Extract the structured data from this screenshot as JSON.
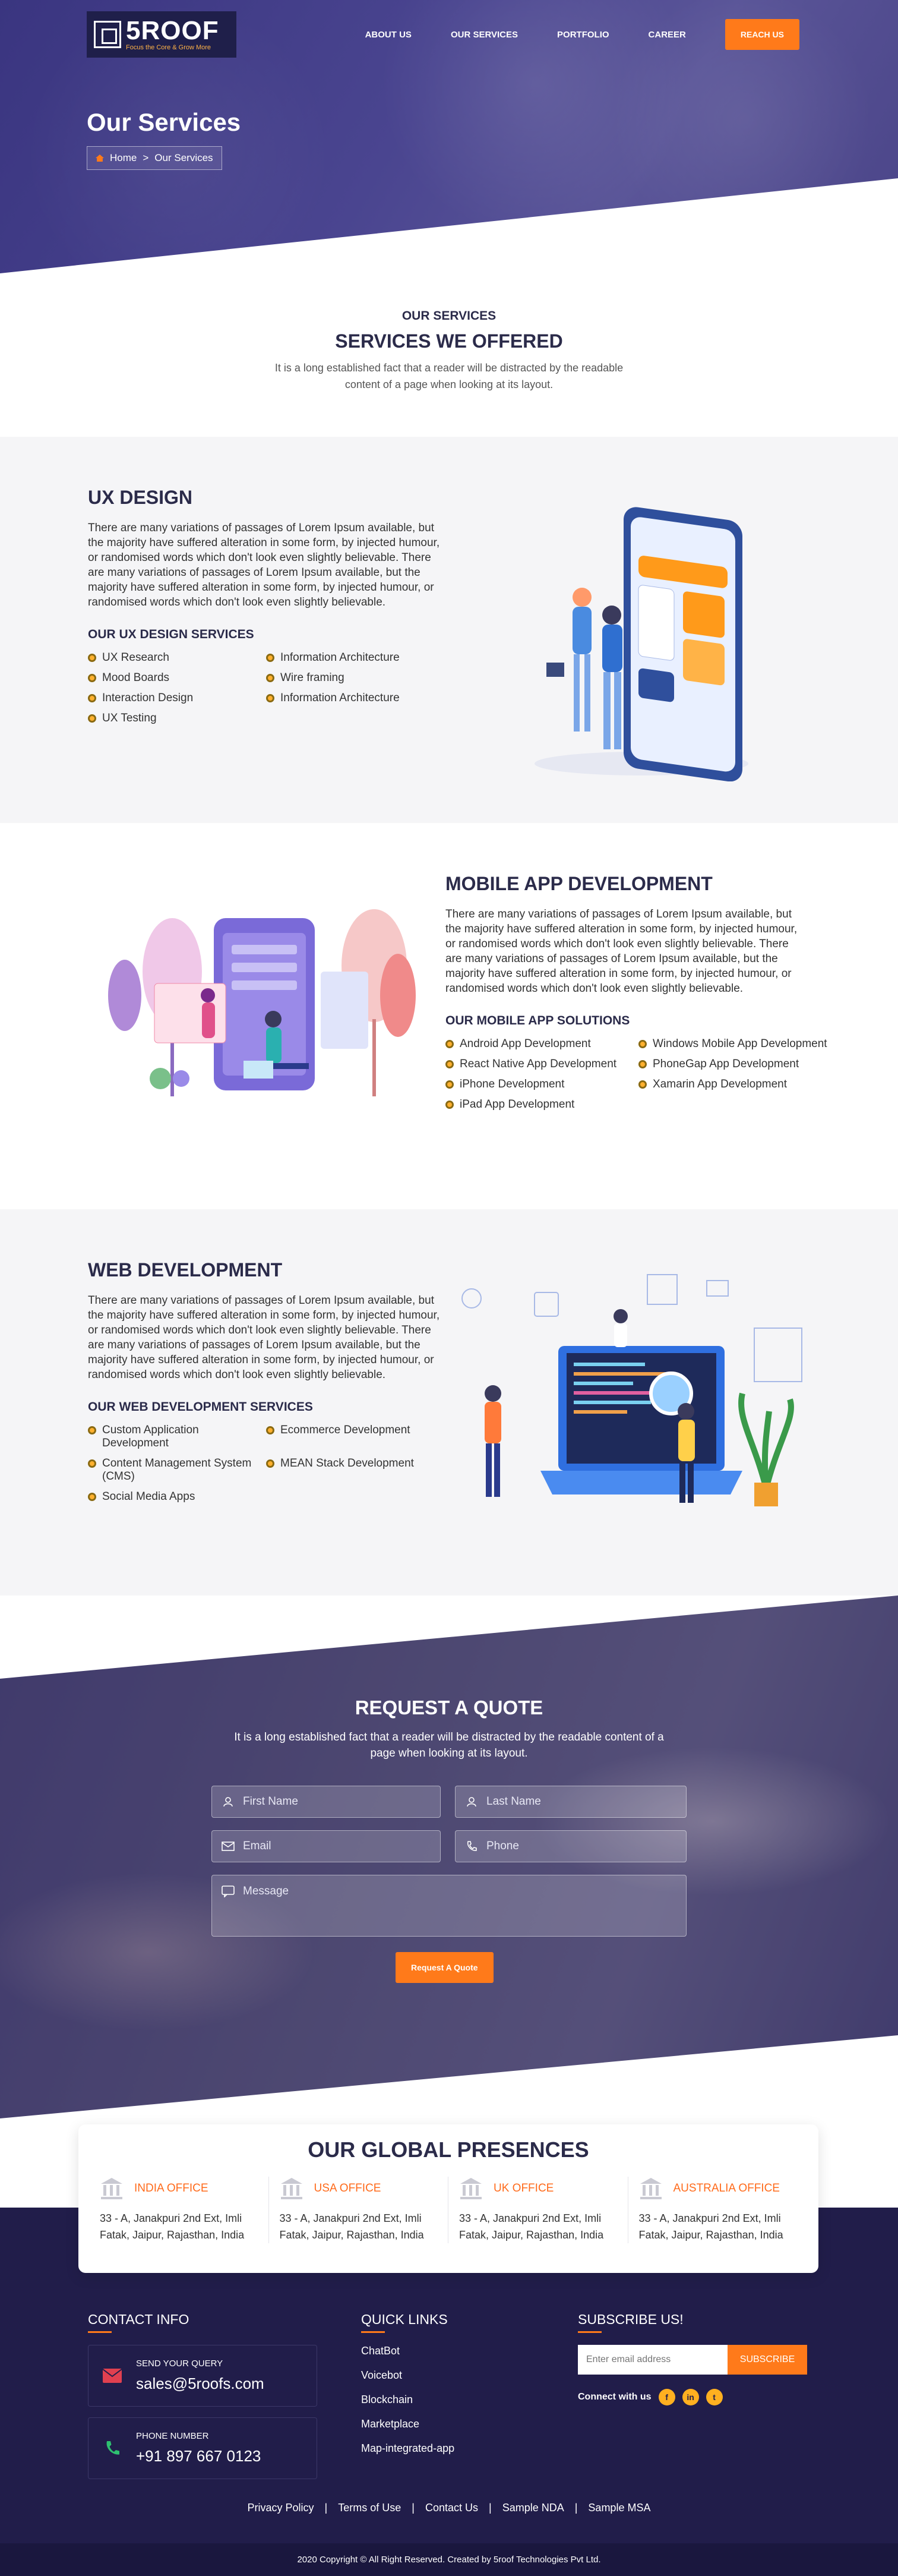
{
  "nav": {
    "logo_name": "5ROOF",
    "logo_tagline": "Focus the Core & Grow More",
    "items": [
      "ABOUT US",
      "OUR SERVICES",
      "PORTFOLIO",
      "CAREER"
    ],
    "cta": "REACH US"
  },
  "hero": {
    "title": "Our Services",
    "breadcrumb": [
      "Home",
      ">",
      "Our Services"
    ]
  },
  "intro": {
    "kicker": "OUR SERVICES",
    "title": "SERVICES WE OFFERED",
    "text": "It is a long established fact that a reader will be distracted by the readable content of a page when looking at its layout."
  },
  "services": [
    {
      "title": "UX DESIGN",
      "text": "There are many variations of passages of Lorem Ipsum available, but the majority have suffered alteration in some form, by injected humour, or randomised words which don't look even slightly believable. There are many variations of passages of Lorem Ipsum available, but the majority have suffered alteration in some form, by injected humour, or randomised words which don't look even slightly believable.",
      "subtitle": "OUR UX DESIGN SERVICES",
      "items": [
        "UX Research",
        "Information Architecture",
        "Mood Boards",
        "Wire framing",
        "Interaction Design",
        "Information Architecture",
        "UX Testing"
      ]
    },
    {
      "title": "MOBILE APP DEVELOPMENT",
      "text": "There are many variations of passages of Lorem Ipsum available, but the majority have suffered alteration in some form, by injected humour, or randomised words which don't look even slightly believable. There are many variations of passages of Lorem Ipsum available, but the majority have suffered alteration in some form, by injected humour, or randomised words which don't look even slightly believable.",
      "subtitle": "OUR MOBILE APP SOLUTIONS",
      "items": [
        "Android App Development",
        "Windows Mobile App Development",
        "React Native App Development",
        "PhoneGap App Development",
        "iPhone Development",
        "Xamarin App Development",
        "iPad App Development"
      ]
    },
    {
      "title": "WEB DEVELOPMENT",
      "text": "There are many variations of passages of Lorem Ipsum available, but the majority have suffered alteration in some form, by injected humour, or randomised words which don't look even slightly believable. There are many variations of passages of Lorem Ipsum available, but the majority have suffered alteration in some form, by injected humour, or randomised words which don't look even slightly believable.",
      "subtitle": "OUR WEB DEVELOPMENT SERVICES",
      "items": [
        "Custom Application Development",
        "Ecommerce Development",
        "Content Management System (CMS)",
        "MEAN Stack Development",
        "Social Media Apps"
      ]
    }
  ],
  "quote": {
    "title": "REQUEST A QUOTE",
    "text": "It is a long established fact that a reader will be distracted by the readable content of a page when looking at its layout.",
    "first_name": "First Name",
    "last_name": "Last Name",
    "email": "Email",
    "phone": "Phone",
    "message": "Message",
    "button": "Request A Quote"
  },
  "global": {
    "title": "OUR GLOBAL PRESENCES",
    "offices": [
      {
        "name": "INDIA OFFICE",
        "address": "33 - A, Janakpuri 2nd Ext, Imli Fatak, Jaipur, Rajasthan, India"
      },
      {
        "name": "USA OFFICE",
        "address": "33 - A, Janakpuri 2nd Ext, Imli Fatak, Jaipur, Rajasthan, India"
      },
      {
        "name": "UK OFFICE",
        "address": "33 - A, Janakpuri 2nd Ext, Imli Fatak, Jaipur, Rajasthan, India"
      },
      {
        "name": "AUSTRALIA OFFICE",
        "address": "33 - A, Janakpuri 2nd Ext, Imli Fatak, Jaipur, Rajasthan, India"
      }
    ]
  },
  "footer": {
    "contact_title": "CONTACT INFO",
    "query_label": "SEND YOUR QUERY",
    "email": "sales@5roofs.com",
    "phone_label": "PHONE NUMBER",
    "phone": "+91 897 667 0123",
    "quick_title": "QUICK LINKS",
    "quick_links": [
      "ChatBot",
      "Voicebot",
      "Blockchain",
      "Marketplace",
      "Map-integrated-app"
    ],
    "subscribe_title": "SUBSCRIBE US!",
    "subscribe_placeholder": "Enter email address",
    "subscribe_button": "SUBSCRIBE",
    "connect_label": "Connect with us",
    "social": [
      "f",
      "in",
      "t"
    ],
    "bottom_links": [
      "Privacy Policy",
      "Terms of Use",
      "Contact Us",
      "Sample NDA",
      "Sample MSA"
    ],
    "copyright": "2020 Copyright © All Right Reserved. Created by 5roof Technologies Pvt Ltd."
  },
  "colors": {
    "primary": "#2b2b4a",
    "accent": "#ff7a1a",
    "footer_bg": "#211d4a",
    "bullet": "#ffb02e"
  }
}
